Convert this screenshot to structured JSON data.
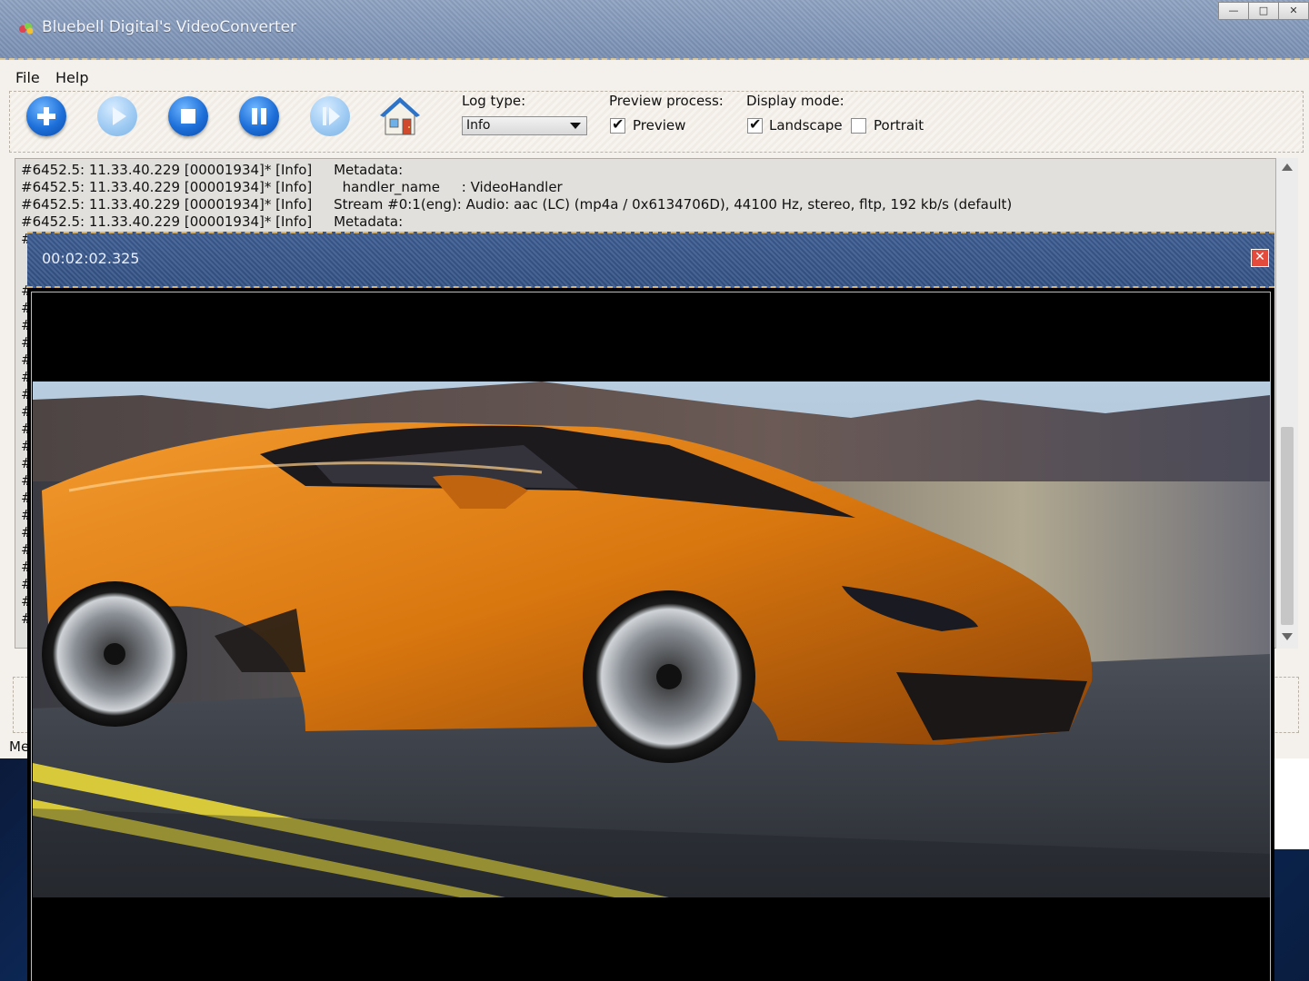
{
  "window": {
    "title": "Bluebell Digital's VideoConverter",
    "controls": [
      "—",
      "□",
      "✕"
    ]
  },
  "menu": {
    "items": [
      "File",
      "Help"
    ]
  },
  "toolbar": {
    "buttons": [
      {
        "icon": "add-icon",
        "enabled": true
      },
      {
        "icon": "play-icon",
        "enabled": false
      },
      {
        "icon": "stop-icon",
        "enabled": true
      },
      {
        "icon": "pause-icon",
        "enabled": true
      },
      {
        "icon": "step-forward-icon",
        "enabled": false
      },
      {
        "icon": "home-icon",
        "enabled": true
      }
    ],
    "log_type": {
      "label": "Log type:",
      "value": "Info"
    },
    "preview_process": {
      "label": "Preview process:",
      "preview_label": "Preview",
      "preview_checked": true
    },
    "display_mode": {
      "label": "Display mode:",
      "landscape_label": "Landscape",
      "landscape_checked": true,
      "portrait_label": "Portrait",
      "portrait_checked": false
    }
  },
  "log": {
    "lines": [
      "#6452.5: 11.33.40.229 [00001934]* [Info]     Metadata:",
      "#6452.5: 11.33.40.229 [00001934]* [Info]       handler_name     : VideoHandler",
      "#6452.5: 11.33.40.229 [00001934]* [Info]     Stream #0:1(eng): Audio: aac (LC) (mp4a / 0x6134706D), 44100 Hz, stereo, fltp, 192 kb/s (default)",
      "#6452.5: 11.33.40.229 [00001934]* [Info]     Metadata:"
    ],
    "hidden_line_prefix": "#"
  },
  "status": {
    "fragment": "Me"
  },
  "preview_window": {
    "timestamp": "00:02:02.325",
    "close_glyph": "✕"
  },
  "colors": {
    "titlebar": "#7f94b8",
    "preview_bar": "#3a5890",
    "button_blue": "#1d6fd9",
    "car_orange": "#d9770f"
  }
}
